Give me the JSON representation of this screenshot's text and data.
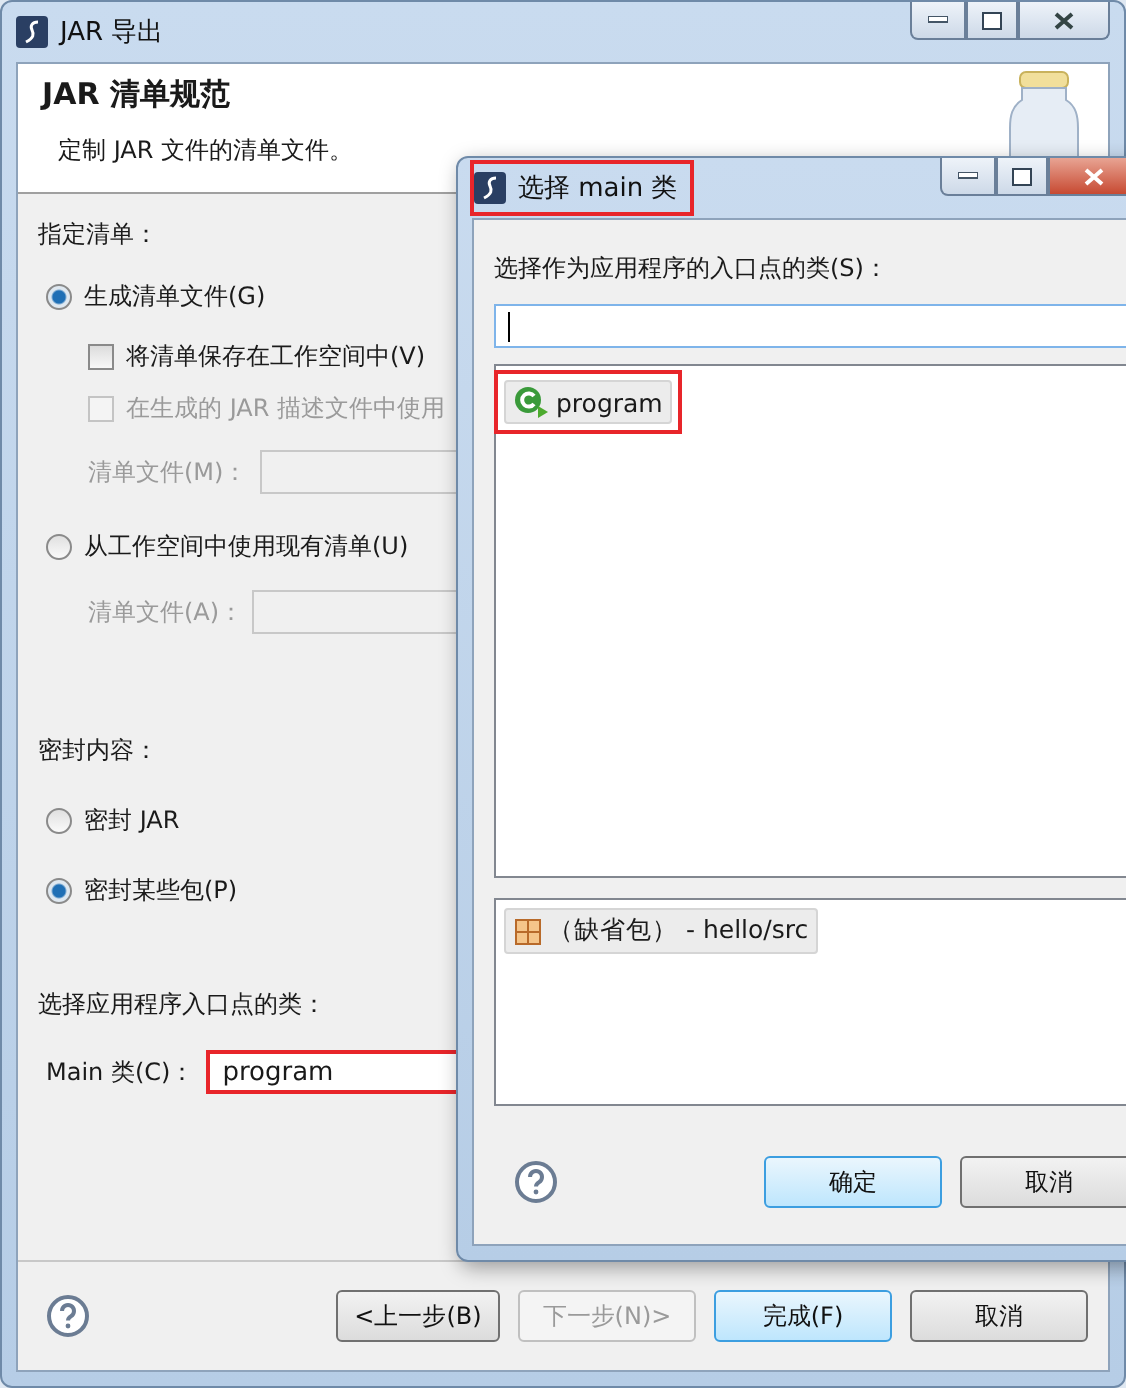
{
  "main_window": {
    "title": "JAR 导出",
    "active": false,
    "header": {
      "title": "JAR 清单规范",
      "description": "定制 JAR 文件的清单文件。"
    },
    "manifest": {
      "heading": "指定清单：",
      "generate": {
        "label": "生成清单文件(G)",
        "selected": true
      },
      "save_in_workspace": {
        "label": "将清单保存在工作空间中(V)",
        "checked": false,
        "disabled": false
      },
      "use_saved": {
        "label": "在生成的 JAR 描述文件中使用",
        "checked": false,
        "disabled": true
      },
      "generated_file": {
        "label": "清单文件(M)：",
        "disabled": true
      },
      "existing": {
        "label": "从工作空间中使用现有清单(U)",
        "selected": false
      },
      "existing_file": {
        "label": "清单文件(A)：",
        "disabled": true
      }
    },
    "sealing": {
      "heading": "密封内容：",
      "options": [
        {
          "label": "密封 JAR",
          "selected": false
        },
        {
          "label": "密封某些包(P)",
          "selected": true
        }
      ]
    },
    "entry_point": {
      "heading": "选择应用程序入口点的类：",
      "label": "Main 类(C)：",
      "value": "program",
      "highlighted": true
    },
    "buttons": [
      {
        "label": "<上一步(B)",
        "disabled": false,
        "default": false
      },
      {
        "label": "下一步(N)>",
        "disabled": true,
        "default": false
      },
      {
        "label": "完成(F)",
        "disabled": false,
        "default": true
      },
      {
        "label": "取消",
        "disabled": false,
        "default": false
      }
    ]
  },
  "dialog": {
    "title": "选择 main 类",
    "active": true,
    "title_highlighted": true,
    "prompt": "选择作为应用程序的入口点的类(S)：",
    "classes": [
      {
        "name": "program",
        "selected": true,
        "highlighted": true
      }
    ],
    "packages": [
      {
        "name": "（缺省包） - hello/src",
        "selected": true
      }
    ],
    "buttons": [
      {
        "label": "确定",
        "default": true
      },
      {
        "label": "取消",
        "default": false
      }
    ]
  }
}
